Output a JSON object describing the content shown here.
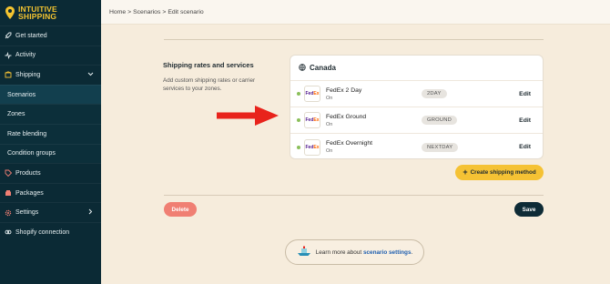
{
  "brand": {
    "line1": "INTUITIVE",
    "line2": "SHIPPING"
  },
  "sidebar": {
    "items": [
      {
        "label": "Get started",
        "icon": "rocket-icon"
      },
      {
        "label": "Activity",
        "icon": "activity-icon"
      },
      {
        "label": "Shipping",
        "icon": "box-icon",
        "expanded": true
      },
      {
        "label": "Scenarios",
        "sub": true,
        "active": true
      },
      {
        "label": "Zones",
        "sub": true
      },
      {
        "label": "Rate blending",
        "sub": true
      },
      {
        "label": "Condition groups",
        "sub": true
      },
      {
        "label": "Products",
        "icon": "tag-icon"
      },
      {
        "label": "Packages",
        "icon": "package-icon"
      },
      {
        "label": "Settings",
        "icon": "gear-icon"
      },
      {
        "label": "Shopify connection",
        "icon": "link-icon"
      }
    ]
  },
  "breadcrumb": {
    "home": "Home",
    "scenarios": "Scenarios",
    "current": "Edit scenario",
    "sep": ">"
  },
  "section": {
    "title": "Shipping rates and services",
    "description": "Add custom shipping rates or carrier services to your zones."
  },
  "zone": {
    "name": "Canada",
    "methods": [
      {
        "name": "FedEx 2 Day",
        "status": "On",
        "code": "2DAY",
        "edit": "Edit"
      },
      {
        "name": "FedEx Ground",
        "status": "On",
        "code": "GROUND",
        "edit": "Edit"
      },
      {
        "name": "FedEx Overnight",
        "status": "On",
        "code": "NEXTDAY",
        "edit": "Edit"
      }
    ]
  },
  "actions": {
    "create": "Create shipping method",
    "delete": "Delete",
    "save": "Save"
  },
  "learn": {
    "prefix": "Learn more about",
    "link": "scenario settings",
    "suffix": "."
  },
  "colors": {
    "sidebar": "#0b2a35",
    "accent_yellow": "#f5c234",
    "delete_red": "#f07f73",
    "save_dark": "#0e2b36",
    "arrow_red": "#e8231c",
    "status_green": "#8bbf5a",
    "background": "#f6ecdc"
  }
}
